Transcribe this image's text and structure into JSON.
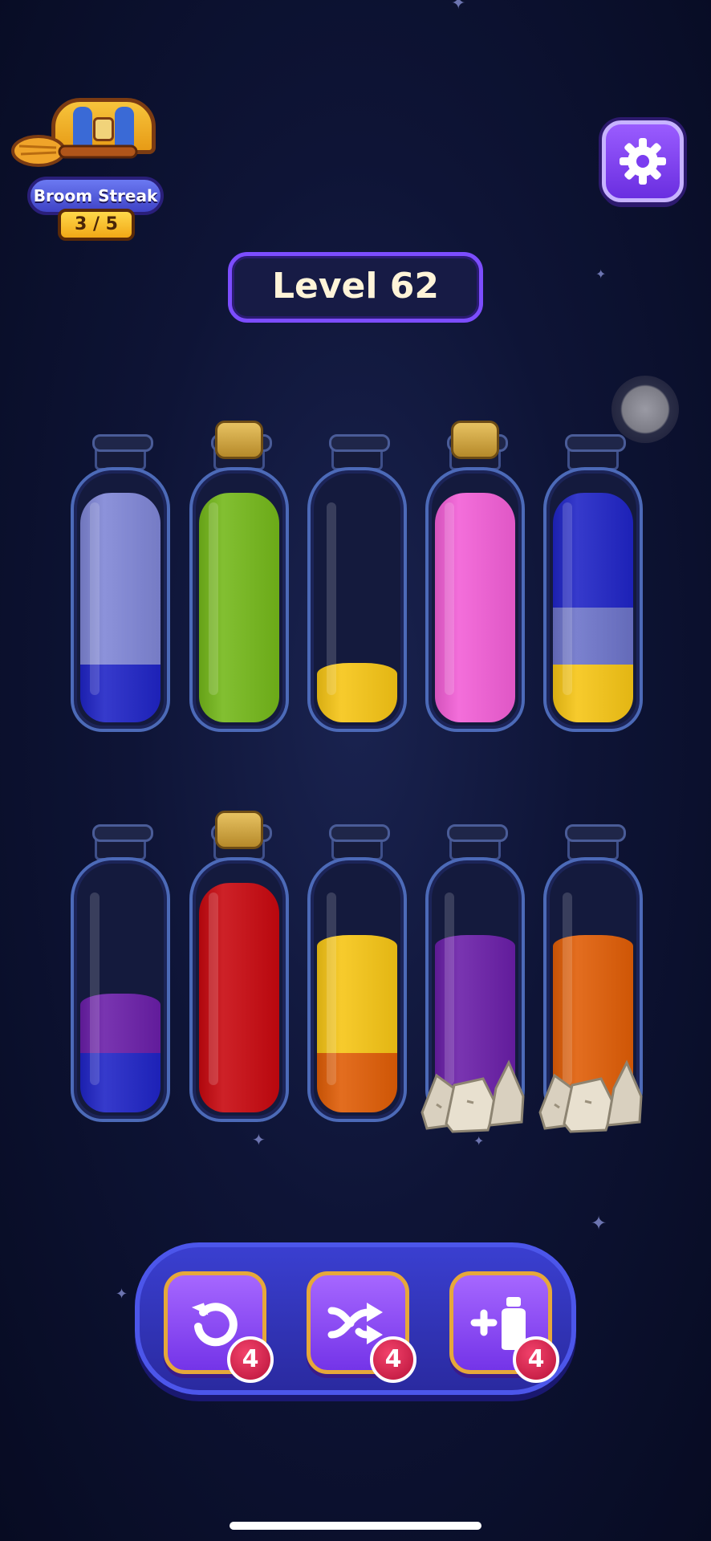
{
  "streak": {
    "label": "Broom Streak",
    "count": "3 / 5"
  },
  "level": {
    "label": "Level 62"
  },
  "colors": {
    "periwinkle": "#7f86d6",
    "blue": "#1f24c6",
    "green": "#74b81a",
    "yellow": "#f6c515",
    "pink": "#f25ed6",
    "purple": "#6a1ea8",
    "red": "#c8080f",
    "orange": "#e05d06"
  },
  "bottles": [
    {
      "id": "b1",
      "cork": false,
      "rock": false,
      "layers": [
        {
          "color": "#1f24c6",
          "fill": 0.25
        },
        {
          "color": "#7f86d6",
          "fill": 0.75
        }
      ]
    },
    {
      "id": "b2",
      "cork": true,
      "rock": false,
      "layers": [
        {
          "color": "#74b81a",
          "fill": 1.0
        }
      ]
    },
    {
      "id": "b3",
      "cork": false,
      "rock": false,
      "layers": [
        {
          "color": "#f6c515",
          "fill": 0.25
        }
      ]
    },
    {
      "id": "b4",
      "cork": true,
      "rock": false,
      "layers": [
        {
          "color": "#f25ed6",
          "fill": 1.0
        }
      ]
    },
    {
      "id": "b5",
      "cork": false,
      "rock": false,
      "layers": [
        {
          "color": "#f6c515",
          "fill": 0.25
        },
        {
          "color": "#6c73c9",
          "fill": 0.25
        },
        {
          "color": "#1f24c6",
          "fill": 0.5
        }
      ]
    },
    {
      "id": "b6",
      "cork": false,
      "rock": false,
      "layers": [
        {
          "color": "#1f24c6",
          "fill": 0.25
        },
        {
          "color": "#6a1ea8",
          "fill": 0.25
        }
      ]
    },
    {
      "id": "b7",
      "cork": true,
      "rock": false,
      "layers": [
        {
          "color": "#c8080f",
          "fill": 1.0
        }
      ]
    },
    {
      "id": "b8",
      "cork": false,
      "rock": false,
      "layers": [
        {
          "color": "#e05d06",
          "fill": 0.25
        },
        {
          "color": "#f6c515",
          "fill": 0.5
        }
      ]
    },
    {
      "id": "b9",
      "cork": false,
      "rock": true,
      "layers": [
        {
          "color": "#6a1ea8",
          "fill": 0.75
        }
      ]
    },
    {
      "id": "b10",
      "cork": false,
      "rock": true,
      "layers": [
        {
          "color": "#e05d06",
          "fill": 0.75
        }
      ]
    }
  ],
  "tools": [
    {
      "name": "undo",
      "icon": "undo-icon",
      "count": "4"
    },
    {
      "name": "shuffle",
      "icon": "shuffle-icon",
      "count": "4"
    },
    {
      "name": "add-bottle",
      "icon": "add-bottle-icon",
      "count": "4"
    }
  ]
}
